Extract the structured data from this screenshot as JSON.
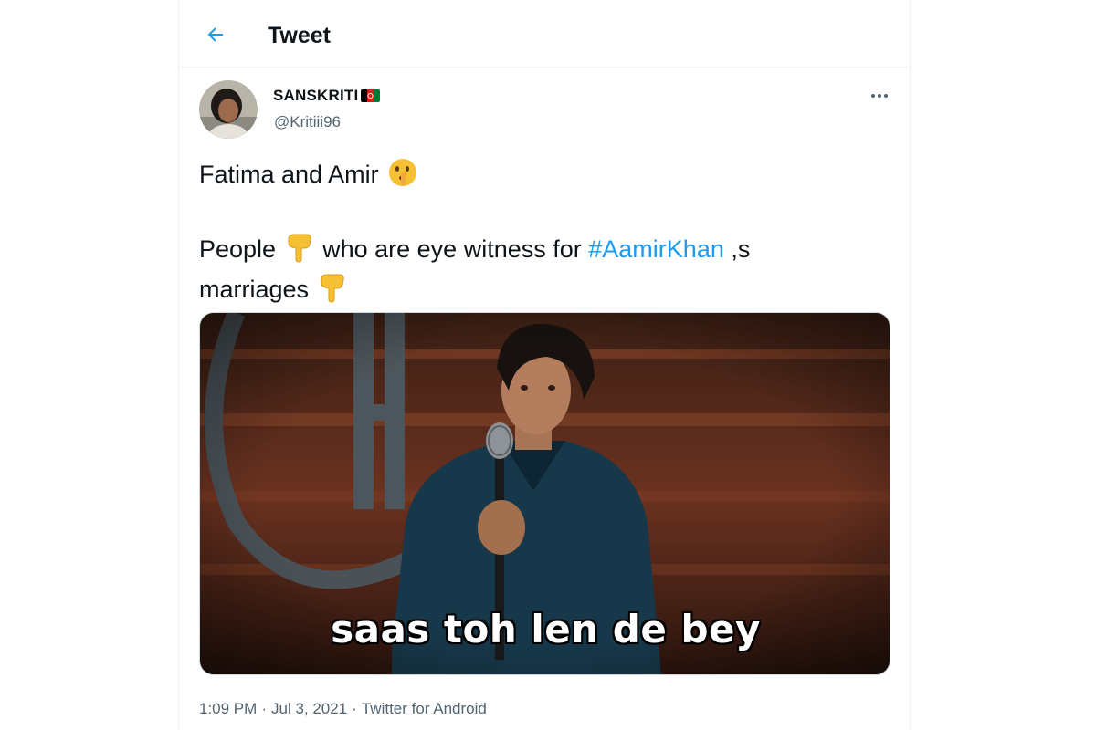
{
  "header": {
    "title": "Tweet"
  },
  "author": {
    "display_name": "SANSKRITI",
    "handle": "@Kritiii96"
  },
  "tweet": {
    "line1": "Fatima and Amir",
    "line2_before": "People",
    "line2_middle": "who are eye witness for",
    "hashtag": "#AamirKhan",
    "line2_after": " ,s",
    "line3": "marriages"
  },
  "media": {
    "caption": "saas toh len de bey"
  },
  "meta": {
    "time": "1:09 PM",
    "separator": "·",
    "date": "Jul 3, 2021",
    "source": "Twitter for Android"
  },
  "colors": {
    "accent": "#1d9bf0",
    "text": "#0f1419",
    "secondary": "#536471"
  },
  "icons": {
    "back": "arrow-left-icon",
    "more": "more-horizontal-icon",
    "flag": "afghanistan-flag-icon",
    "shush": "shushing-face-emoji",
    "point_down": "backhand-index-pointing-down-emoji"
  }
}
